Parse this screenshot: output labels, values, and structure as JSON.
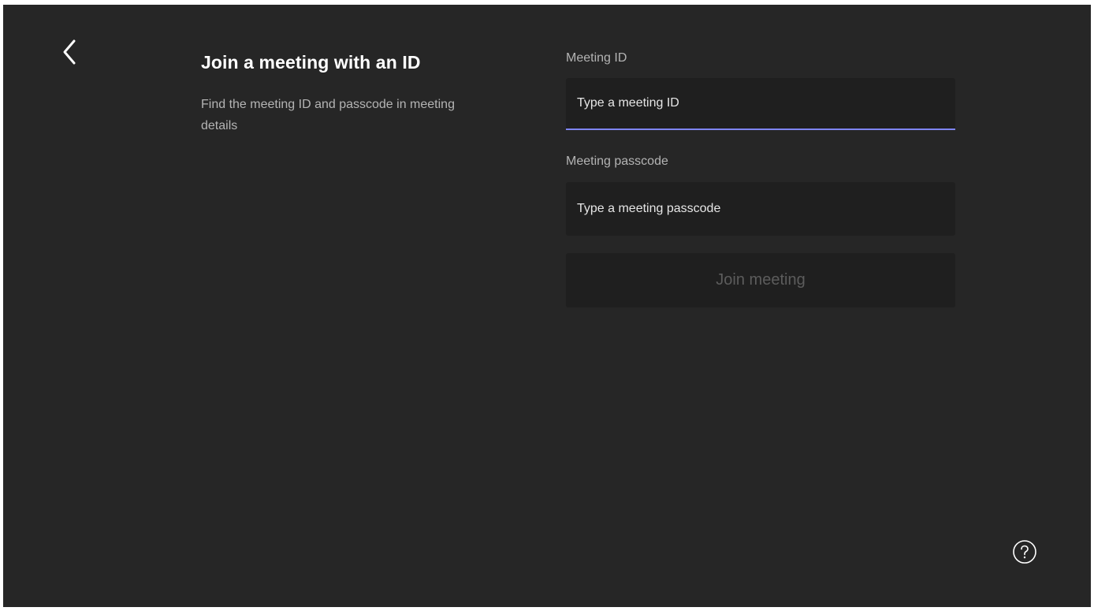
{
  "page": {
    "heading": "Join a meeting with an ID",
    "subtext": "Find the meeting ID and passcode in meeting details"
  },
  "meeting_id": {
    "label": "Meeting ID",
    "placeholder": "Type a meeting ID",
    "value": ""
  },
  "meeting_passcode": {
    "label": "Meeting passcode",
    "placeholder": "Type a meeting passcode",
    "value": ""
  },
  "join_button": {
    "label": "Join meeting",
    "state": "disabled"
  },
  "icons": {
    "back": "chevron-left-icon",
    "help": "question-circle-icon"
  },
  "colors": {
    "background": "#262626",
    "input_background": "#1f1f1f",
    "accent_underline": "#7f85f5",
    "muted_text": "#b4b4b4",
    "disabled_text": "#5c5c5c"
  }
}
